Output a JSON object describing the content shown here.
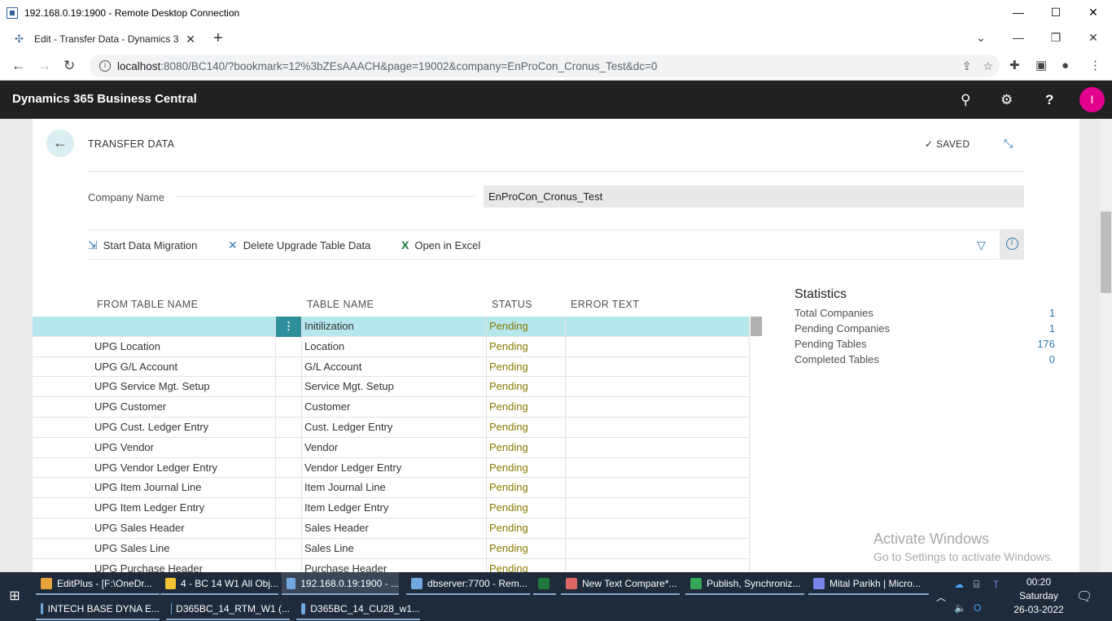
{
  "rdp": {
    "title": "192.168.0.19:1900 - Remote Desktop Connection",
    "min": "—",
    "max": "☐",
    "close": "✕"
  },
  "browser": {
    "tab_title": "Edit - Transfer Data - Dynamics 3",
    "tab_close": "✕",
    "new_tab": "+",
    "url_host": "localhost",
    "url_path": ":8080/BC140/?bookmark=12%3bZEsAAACH&page=19002&company=EnProCon_Cronus_Test&dc=0",
    "window_controls": {
      "tabs_list": "⌄",
      "min": "—",
      "restore": "❐",
      "close": "✕"
    }
  },
  "app": {
    "title": "Dynamics 365 Business Central",
    "avatar_initial": "I",
    "help": "?"
  },
  "page": {
    "title": "TRANSFER DATA",
    "saved": "SAVED",
    "field_label": "Company Name",
    "field_value": "EnProCon_Cronus_Test",
    "actions": {
      "start": "Start Data Migration",
      "delete": "Delete Upgrade Table Data",
      "excel": "Open in Excel"
    }
  },
  "grid": {
    "headers": [
      "FROM TABLE NAME",
      "TABLE NAME",
      "STATUS",
      "ERROR TEXT"
    ],
    "rows": [
      {
        "from": "",
        "table": "Initilization",
        "status": "Pending",
        "error": ""
      },
      {
        "from": "UPG Location",
        "table": "Location",
        "status": "Pending",
        "error": ""
      },
      {
        "from": "UPG G/L Account",
        "table": "G/L Account",
        "status": "Pending",
        "error": ""
      },
      {
        "from": "UPG Service Mgt. Setup",
        "table": "Service Mgt. Setup",
        "status": "Pending",
        "error": ""
      },
      {
        "from": "UPG Customer",
        "table": "Customer",
        "status": "Pending",
        "error": ""
      },
      {
        "from": "UPG Cust. Ledger Entry",
        "table": "Cust. Ledger Entry",
        "status": "Pending",
        "error": ""
      },
      {
        "from": "UPG Vendor",
        "table": "Vendor",
        "status": "Pending",
        "error": ""
      },
      {
        "from": "UPG Vendor Ledger Entry",
        "table": "Vendor Ledger Entry",
        "status": "Pending",
        "error": ""
      },
      {
        "from": "UPG Item Journal Line",
        "table": "Item Journal Line",
        "status": "Pending",
        "error": ""
      },
      {
        "from": "UPG Item Ledger Entry",
        "table": "Item Ledger Entry",
        "status": "Pending",
        "error": ""
      },
      {
        "from": "UPG Sales Header",
        "table": "Sales Header",
        "status": "Pending",
        "error": ""
      },
      {
        "from": "UPG Sales Line",
        "table": "Sales Line",
        "status": "Pending",
        "error": ""
      },
      {
        "from": "UPG Purchase Header",
        "table": "Purchase Header",
        "status": "Pending",
        "error": ""
      }
    ]
  },
  "stats": {
    "title": "Statistics",
    "items": [
      {
        "label": "Total Companies",
        "value": "1"
      },
      {
        "label": "Pending Companies",
        "value": "1"
      },
      {
        "label": "Pending Tables",
        "value": "176"
      },
      {
        "label": "Completed Tables",
        "value": "0"
      }
    ]
  },
  "watermark": {
    "line1": "Activate Windows",
    "line2": "Go to Settings to activate Windows."
  },
  "taskbar": {
    "row1": [
      "EditPlus - [F:\\OneDr...",
      "4 - BC 14 W1 All Obj...",
      "192.168.0.19:1900 - ...",
      "dbserver:7700 - Rem...",
      "",
      "New Text Compare*...",
      "Publish, Synchroniz...",
      "Mital Parikh | Micro..."
    ],
    "row2": [
      "INTECH BASE DYNA E...",
      "D365BC_14_RTM_W1 (...",
      "D365BC_14_CU28_w1..."
    ],
    "time": "00:20",
    "day": "Saturday",
    "date": "26-03-2022"
  },
  "colors": {
    "accent": "#2a7aaf",
    "header": "#212121",
    "selected_row": "#b5e7ec",
    "pending": "#8a7a00",
    "avatar": "#e3008c"
  }
}
